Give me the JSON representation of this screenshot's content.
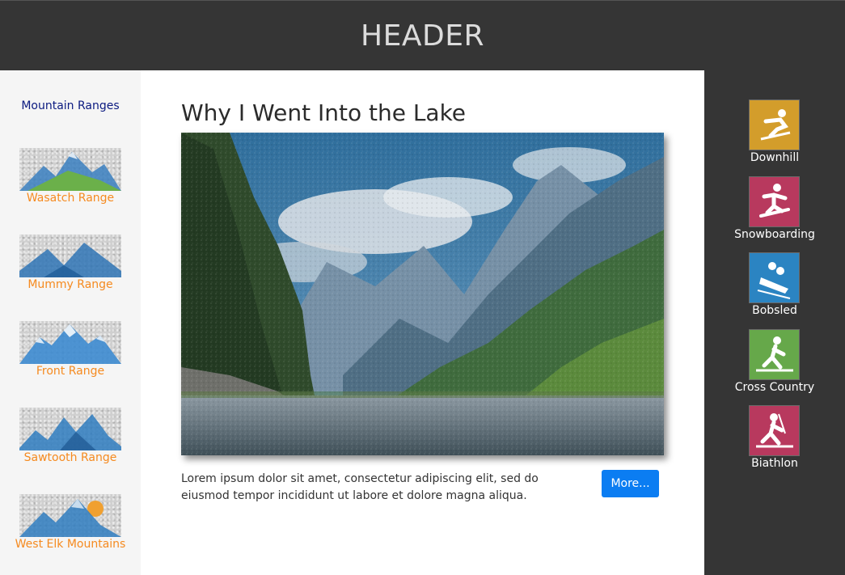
{
  "header": {
    "title": "HEADER"
  },
  "sidebar": {
    "title": "Mountain Ranges",
    "ranges": [
      {
        "label": "Wasatch Range",
        "icon": "mountain-icon"
      },
      {
        "label": "Mummy Range",
        "icon": "mountain-icon"
      },
      {
        "label": "Front Range",
        "icon": "mountain-icon"
      },
      {
        "label": "Sawtooth Range",
        "icon": "mountain-icon"
      },
      {
        "label": "West Elk Mountains",
        "icon": "mountain-sun-icon"
      }
    ]
  },
  "article": {
    "title": "Why I Went Into the Lake",
    "body": "Lorem ipsum dolor sit amet, consectetur adipiscing elit, sed do eiusmod tempor incididunt ut labore et dolore magna aliqua.",
    "more_label": "More..."
  },
  "sports": [
    {
      "label": "Downhill",
      "icon": "downhill-skier-icon",
      "color": "#d39d2b"
    },
    {
      "label": "Snowboarding",
      "icon": "snowboarder-icon",
      "color": "#b8395e"
    },
    {
      "label": "Bobsled",
      "icon": "bobsled-icon",
      "color": "#2b84c2"
    },
    {
      "label": "Cross Country",
      "icon": "cross-country-skier-icon",
      "color": "#66a84a"
    },
    {
      "label": "Biathlon",
      "icon": "biathlon-icon",
      "color": "#b8395e"
    }
  ],
  "colors": {
    "header_bg": "#353535",
    "range_label": "#f58a1f",
    "sidebar_title": "#0b1a80",
    "button": "#0b7df2"
  }
}
